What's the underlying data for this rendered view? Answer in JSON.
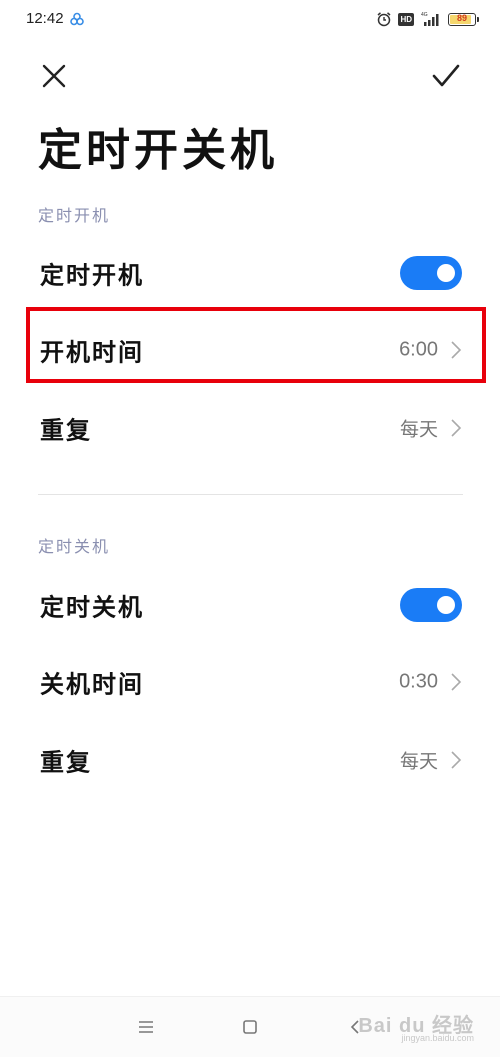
{
  "status_bar": {
    "time": "12:42",
    "battery": "89",
    "battery_level": 0.89,
    "network": "4G"
  },
  "header": {
    "close_icon": "close-icon",
    "confirm_icon": "checkmark-icon",
    "title": "定时开关机"
  },
  "power_on": {
    "section_label": "定时开机",
    "toggle_label": "定时开机",
    "toggle_on": true,
    "time_label": "开机时间",
    "time_value": "6:00",
    "repeat_label": "重复",
    "repeat_value": "每天"
  },
  "power_off": {
    "section_label": "定时关机",
    "toggle_label": "定时关机",
    "toggle_on": true,
    "time_label": "关机时间",
    "time_value": "0:30",
    "repeat_label": "重复",
    "repeat_value": "每天"
  },
  "colors": {
    "accent": "#1a7cf6",
    "highlight": "#e8000b",
    "section_label": "#8a8fb0"
  },
  "nav_bar": {
    "menu_icon": "menu-icon",
    "home_icon": "home-icon",
    "back_icon": "back-icon",
    "watermark": "Bai du 经验",
    "watermark_sub": "jingyan.baidu.com"
  }
}
